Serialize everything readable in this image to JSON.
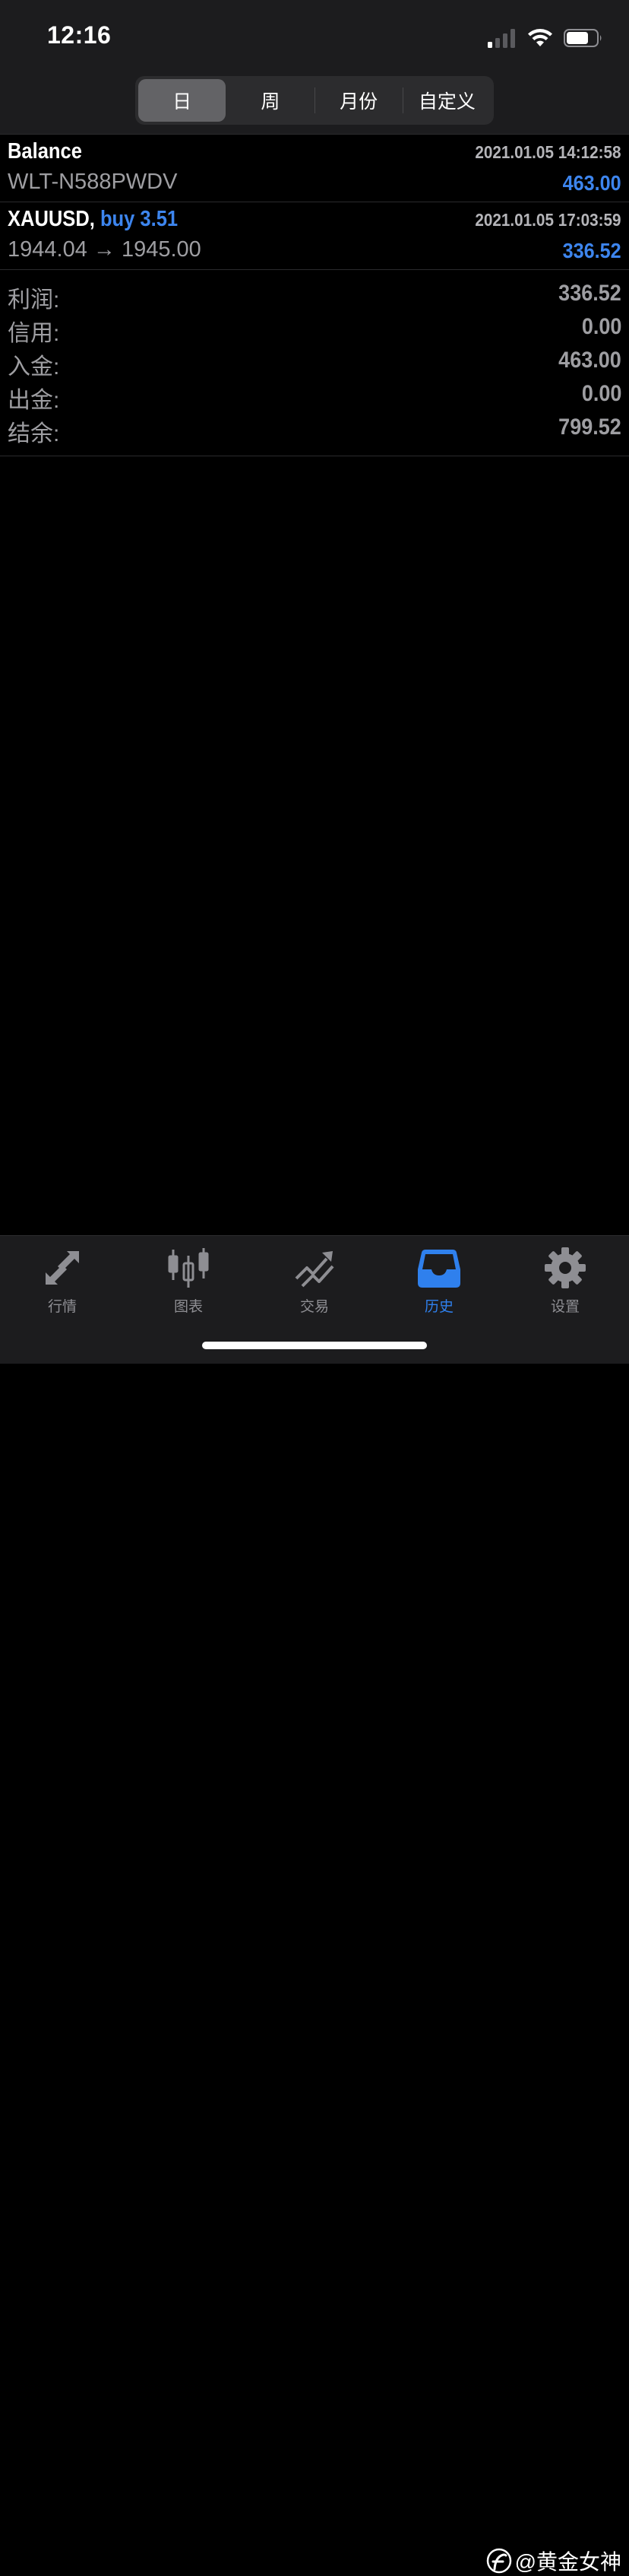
{
  "status_bar": {
    "time": "12:16"
  },
  "segments": [
    {
      "label": "日",
      "active": true
    },
    {
      "label": "周",
      "active": false
    },
    {
      "label": "月份",
      "active": false
    },
    {
      "label": "自定义",
      "active": false
    }
  ],
  "deals": [
    {
      "title": "Balance",
      "type_volume": "",
      "subtitle": "WLT-N588PWDV",
      "time": "2021.01.05 14:12:58",
      "amount": "463.00"
    },
    {
      "title": "XAUUSD,",
      "type_volume": "buy 3.51",
      "subtitle": "1944.04 → 1945.00",
      "time": "2021.01.05 17:03:59",
      "amount": "336.52"
    }
  ],
  "summary": [
    {
      "label": "利润:",
      "value": "336.52"
    },
    {
      "label": "信用:",
      "value": "0.00"
    },
    {
      "label": "入金:",
      "value": "463.00"
    },
    {
      "label": "出金:",
      "value": "0.00"
    },
    {
      "label": "结余:",
      "value": "799.52"
    }
  ],
  "tabs": [
    {
      "label": "行情",
      "icon": "quotes-icon",
      "active": false
    },
    {
      "label": "图表",
      "icon": "chart-candles-icon",
      "active": false
    },
    {
      "label": "交易",
      "icon": "trade-icon",
      "active": false
    },
    {
      "label": "历史",
      "icon": "history-inbox-icon",
      "active": true
    },
    {
      "label": "设置",
      "icon": "gear-icon",
      "active": false
    }
  ],
  "watermark": {
    "text": "@黄金女神"
  },
  "colors": {
    "accent": "#3d85ee",
    "tab_active": "#2f80ed",
    "muted": "#9e9ea2",
    "bar_bg": "#1c1c1e"
  }
}
